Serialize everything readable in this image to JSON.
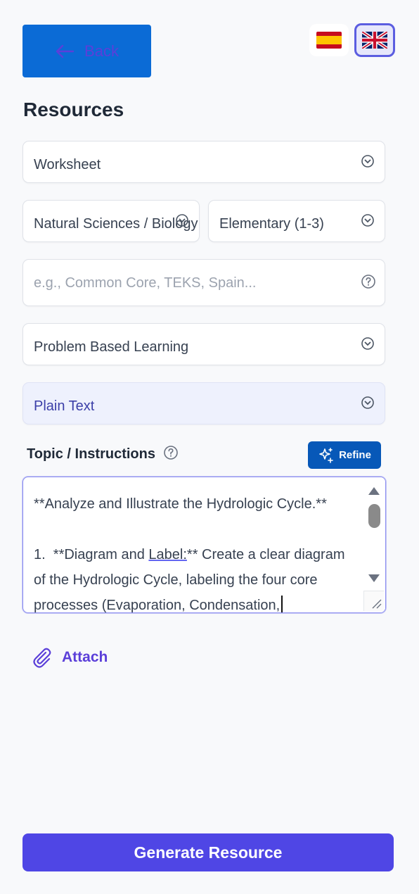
{
  "header": {
    "back_label": "Back",
    "languages": [
      {
        "name": "Spanish flag",
        "code": "es",
        "selected": false
      },
      {
        "name": "UK flag",
        "code": "en",
        "selected": true
      }
    ]
  },
  "page_title": "Resources",
  "form": {
    "resource_type": "Worksheet",
    "subject": "Natural Sciences / Biology",
    "grade": "Elementary (1-3)",
    "standard_placeholder": "e.g., Common Core, TEKS, Spain...",
    "method": "Problem Based Learning",
    "format": "Plain Text",
    "topic_label": "Topic / Instructions",
    "refine_label": "Refine",
    "topic_line1": "**Analyze and Illustrate the Hydrologic Cycle.**",
    "topic_line3_a": "1.  **Diagram and ",
    "topic_line3_link": "Label:",
    "topic_line3_b": "** Create a clear diagram of the Hydrologic Cycle, labeling the four core processes (Evaporation, Condensation,",
    "attach_label": "Attach"
  },
  "generate_label": "Generate Resource",
  "colors": {
    "primary": "#4f46e5",
    "back_button": "#0b6bd6",
    "refine_button": "#0758b8",
    "format_bg": "#eef1fd"
  }
}
